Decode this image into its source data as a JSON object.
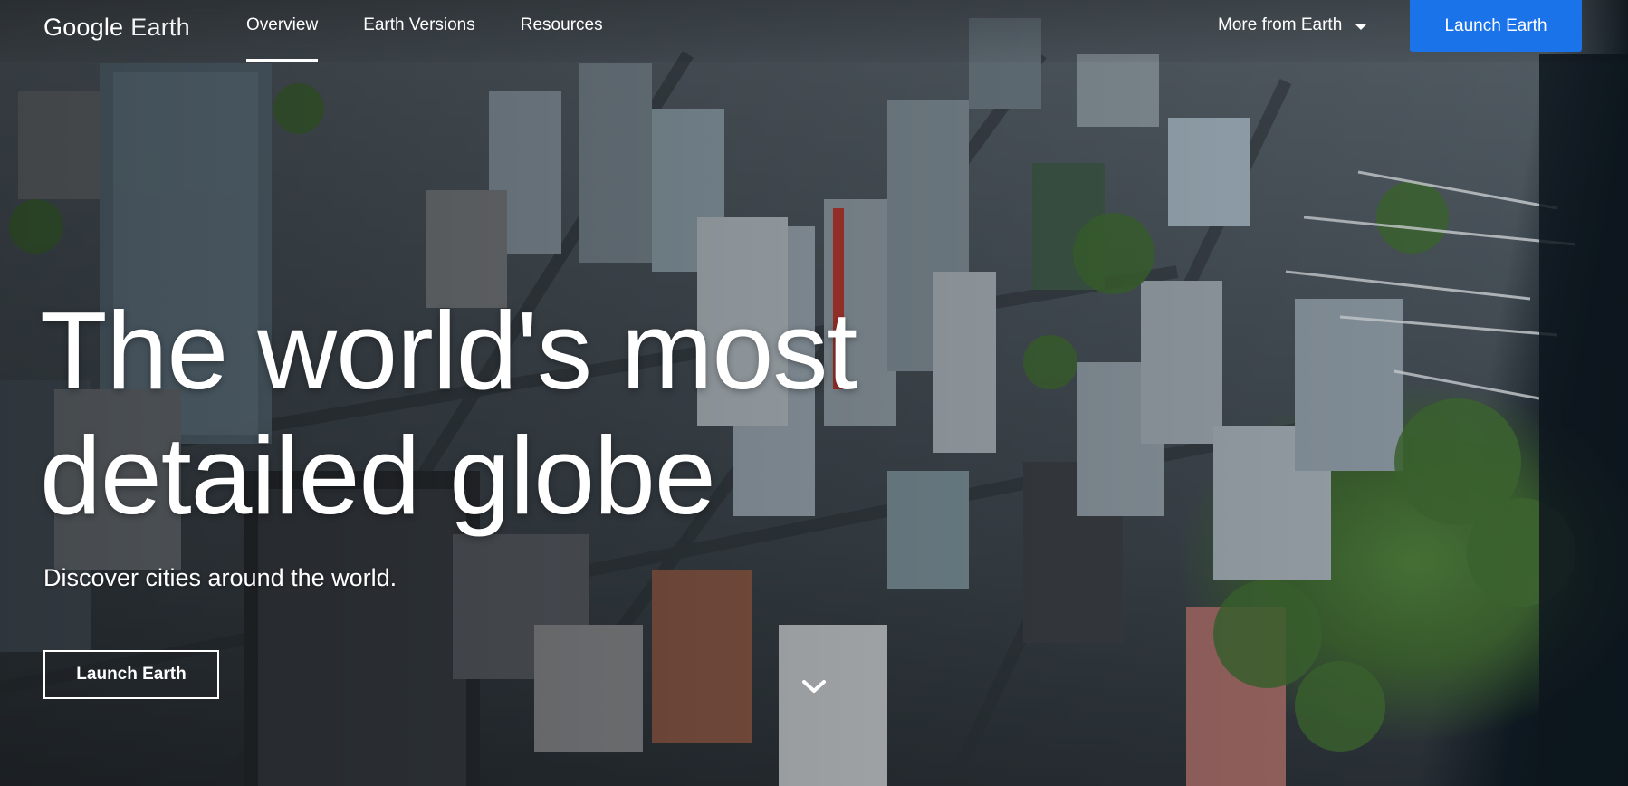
{
  "header": {
    "logo_google": "Google",
    "logo_product": "Earth",
    "tabs": [
      {
        "label": "Overview",
        "active": true
      },
      {
        "label": "Earth Versions",
        "active": false
      },
      {
        "label": "Resources",
        "active": false
      }
    ],
    "more_label": "More from Earth",
    "launch_label": "Launch Earth"
  },
  "hero": {
    "headline_line1": "The world's most",
    "headline_line2": "detailed globe",
    "subhead": "Discover cities around the world.",
    "cta_label": "Launch Earth",
    "background": "aerial-city-photo"
  },
  "icons": {
    "more_caret": "caret-down-icon",
    "scroll": "chevron-down-icon"
  },
  "colors": {
    "accent": "#1a73e8",
    "text": "#ffffff"
  }
}
